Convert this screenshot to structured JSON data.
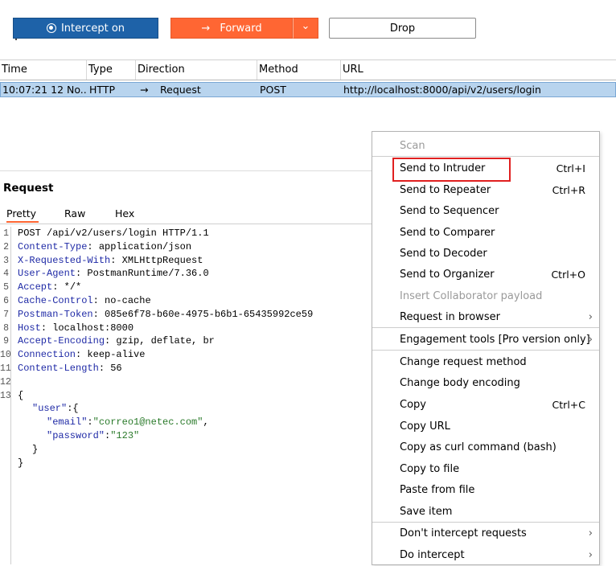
{
  "toolbar": {
    "intercept_label": "Intercept on",
    "forward_label": "Forward",
    "forward_arrow": "→",
    "forward_dropdown": "⌄",
    "drop_label": "Drop"
  },
  "table": {
    "headers": [
      "Time",
      "Type",
      "Direction",
      "Method",
      "URL"
    ],
    "row": {
      "time": "10:07:21 12 No...",
      "type": "HTTP",
      "direction_arrow": "→",
      "direction": "Request",
      "method": "POST",
      "url": "http://localhost:8000/api/v2/users/login"
    }
  },
  "request": {
    "title": "Request",
    "tabs": [
      "Pretty",
      "Raw",
      "Hex"
    ],
    "active_tab": "Pretty",
    "line_numbers": [
      "1",
      "2",
      "3",
      "4",
      "5",
      "6",
      "7",
      "8",
      "9",
      "10",
      "11",
      "12",
      "13"
    ],
    "request_line": "POST /api/v2/users/login HTTP/1.1",
    "headers": [
      {
        "name": "Content-Type",
        "value": " application/json"
      },
      {
        "name": "X-Requested-With",
        "value": " XMLHttpRequest"
      },
      {
        "name": "User-Agent",
        "value": " PostmanRuntime/7.36.0"
      },
      {
        "name": "Accept",
        "value": " */*"
      },
      {
        "name": "Cache-Control",
        "value": " no-cache"
      },
      {
        "name": "Postman-Token",
        "value": " 085e6f78-b60e-4975-b6b1-65435992ce59"
      },
      {
        "name": "Host",
        "value": " localhost:8000"
      },
      {
        "name": "Accept-Encoding",
        "value": " gzip, deflate, br"
      },
      {
        "name": "Connection",
        "value": " keep-alive"
      },
      {
        "name": "Content-Length",
        "value": " 56"
      }
    ],
    "body": {
      "open": "{",
      "user_key": "\"user\"",
      "user_open": ":{",
      "email_key": "\"email\"",
      "email_val": "\"correo1@netec.com\"",
      "password_key": "\"password\"",
      "password_val": "\"123\"",
      "inner_close": "}",
      "close": "}"
    }
  },
  "context_menu": {
    "items": [
      {
        "label": "Scan",
        "shortcut": "",
        "disabled": true,
        "submenu": false
      },
      {
        "label": "Send to Intruder",
        "shortcut": "Ctrl+I",
        "disabled": false,
        "submenu": false
      },
      {
        "label": "Send to Repeater",
        "shortcut": "Ctrl+R",
        "disabled": false,
        "submenu": false
      },
      {
        "label": "Send to Sequencer",
        "shortcut": "",
        "disabled": false,
        "submenu": false
      },
      {
        "label": "Send to Comparer",
        "shortcut": "",
        "disabled": false,
        "submenu": false
      },
      {
        "label": "Send to Decoder",
        "shortcut": "",
        "disabled": false,
        "submenu": false
      },
      {
        "label": "Send to Organizer",
        "shortcut": "Ctrl+O",
        "disabled": false,
        "submenu": false
      },
      {
        "label": "Insert Collaborator payload",
        "shortcut": "",
        "disabled": true,
        "submenu": false
      },
      {
        "label": "Request in browser",
        "shortcut": "",
        "disabled": false,
        "submenu": true
      },
      {
        "label": "Engagement tools [Pro version only]",
        "shortcut": "",
        "disabled": false,
        "submenu": true
      },
      {
        "label": "Change request method",
        "shortcut": "",
        "disabled": false,
        "submenu": false
      },
      {
        "label": "Change body encoding",
        "shortcut": "",
        "disabled": false,
        "submenu": false
      },
      {
        "label": "Copy",
        "shortcut": "Ctrl+C",
        "disabled": false,
        "submenu": false
      },
      {
        "label": "Copy URL",
        "shortcut": "",
        "disabled": false,
        "submenu": false
      },
      {
        "label": "Copy as curl command (bash)",
        "shortcut": "",
        "disabled": false,
        "submenu": false
      },
      {
        "label": "Copy to file",
        "shortcut": "",
        "disabled": false,
        "submenu": false
      },
      {
        "label": "Paste from file",
        "shortcut": "",
        "disabled": false,
        "submenu": false
      },
      {
        "label": "Save item",
        "shortcut": "",
        "disabled": false,
        "submenu": false
      },
      {
        "label": "Don't intercept requests",
        "shortcut": "",
        "disabled": false,
        "submenu": true
      },
      {
        "label": "Do intercept",
        "shortcut": "",
        "disabled": false,
        "submenu": true
      }
    ],
    "submenu_arrow": "›"
  },
  "colors": {
    "intercept_bg": "#1e62a8",
    "forward_bg": "#ff6633",
    "selected_row": "#b8d4ee",
    "highlight_box": "#e02020",
    "header_name": "#1f2aa6",
    "json_string": "#2a7a2a"
  }
}
